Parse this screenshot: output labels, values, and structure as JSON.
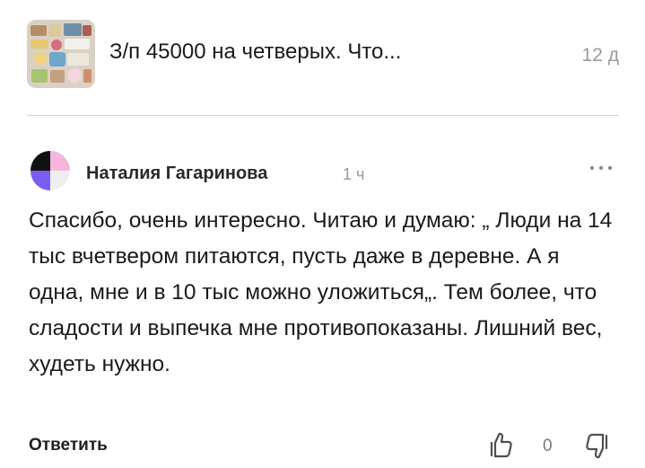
{
  "article": {
    "title": "З/п 45000 на четверых. Что...",
    "age": "12 д"
  },
  "comment": {
    "author": "Наталия Гагаринова",
    "time": "1 ч",
    "text": "Спасибо, очень интересно. Читаю и думаю: „ Люди на 14 тыс вчетвером питаются, пусть даже в деревне. А я одна, мне и в 10 тыс можно уложиться„. Тем более, что сладости и выпечка мне противопоказаны. Лишний вес, худеть нужно.",
    "reply_label": "Ответить",
    "like_count": "0",
    "icons": {
      "avatar": "avatar-icon",
      "more": "more-dots-icon",
      "like": "thumbs-up-icon",
      "dislike": "thumbs-down-icon"
    }
  },
  "colors": {
    "avatar_black": "#111111",
    "avatar_pink": "#f4b6dd",
    "avatar_purple": "#7b5cf0",
    "muted_text": "#9a9a9a",
    "divider": "#d7d7d7"
  }
}
